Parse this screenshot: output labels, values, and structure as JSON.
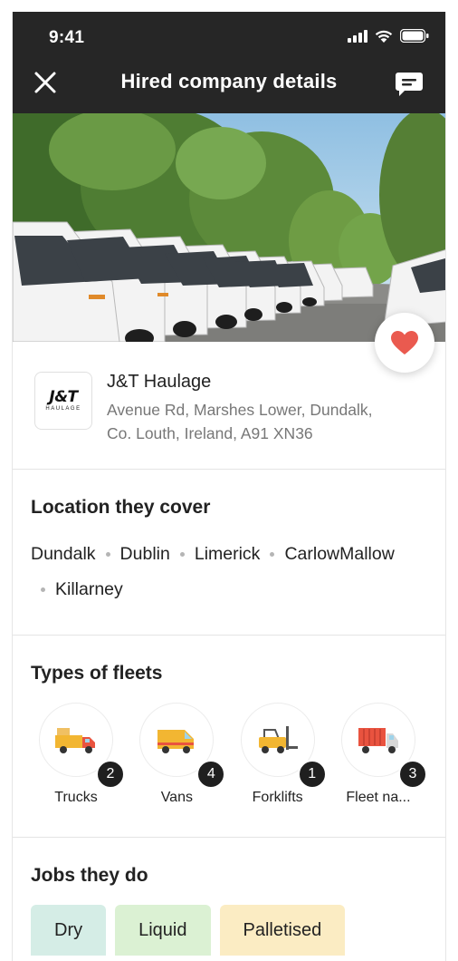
{
  "status": {
    "time": "9:41"
  },
  "nav": {
    "title": "Hired company details"
  },
  "company": {
    "logo_text": "J&T",
    "logo_subtext": "HAULAGE",
    "name": "J&T Haulage",
    "address_line1": "Avenue Rd, Marshes Lower, Dundalk,",
    "address_line2": "Co. Louth, Ireland, A91 XN36"
  },
  "locations": {
    "title": "Location they cover",
    "items": [
      "Dundalk",
      "Dublin",
      "Limerick",
      "Carlow",
      "Mallow",
      "Killarney"
    ]
  },
  "fleets": {
    "title": "Types of fleets",
    "items": [
      {
        "label": "Trucks",
        "count": "2",
        "icon": "truck-icon"
      },
      {
        "label": "Vans",
        "count": "4",
        "icon": "van-icon"
      },
      {
        "label": "Forklifts",
        "count": "1",
        "icon": "forklift-icon"
      },
      {
        "label": "Fleet na...",
        "count": "3",
        "icon": "container-truck-icon"
      }
    ]
  },
  "jobs": {
    "title": "Jobs they do",
    "items": [
      {
        "label": "Dry",
        "color": "#d5ede6"
      },
      {
        "label": "Liquid",
        "color": "#dbf1d3"
      },
      {
        "label": "Palletised",
        "color": "#fbecc3"
      }
    ]
  },
  "colors": {
    "topbar": "#262626",
    "favorite": "#ea5a4f"
  }
}
